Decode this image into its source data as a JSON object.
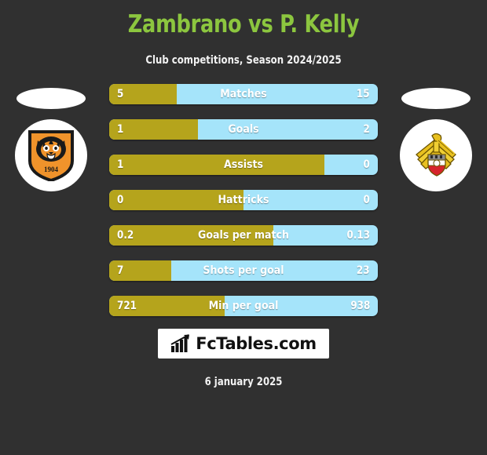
{
  "header": {
    "title": "Zambrano vs P. Kelly",
    "subtitle": "Club competitions, Season 2024/2025",
    "title_color": "#8cc63f",
    "background_color": "#303030"
  },
  "colors": {
    "home_bar": "#b5a41c",
    "away_bar": "#a5e4fa",
    "text": "#ffffff"
  },
  "home_team": {
    "crest_icon": "hull-city-tiger-crest",
    "crest_year": "1904"
  },
  "away_team": {
    "crest_icon": "doncaster-rovers-crest"
  },
  "chart_data": {
    "type": "bar",
    "title": "Zambrano vs P. Kelly",
    "subtitle": "Club competitions, Season 2024/2025",
    "orientation": "horizontal-diverging",
    "legend": [
      "Zambrano",
      "P. Kelly"
    ],
    "categories": [
      "Matches",
      "Goals",
      "Assists",
      "Hattricks",
      "Goals per match",
      "Shots per goal",
      "Min per goal"
    ],
    "series": [
      {
        "name": "Zambrano",
        "color": "#b5a41c",
        "values": [
          5,
          1,
          1,
          0,
          0.2,
          7,
          721
        ]
      },
      {
        "name": "P. Kelly",
        "color": "#a5e4fa",
        "values": [
          15,
          2,
          0,
          0,
          0.13,
          23,
          938
        ]
      }
    ]
  },
  "rows": [
    {
      "label": "Matches",
      "home": "5",
      "away": "15",
      "home_pct": 25
    },
    {
      "label": "Goals",
      "home": "1",
      "away": "2",
      "home_pct": 33
    },
    {
      "label": "Assists",
      "home": "1",
      "away": "0",
      "home_pct": 80
    },
    {
      "label": "Hattricks",
      "home": "0",
      "away": "0",
      "home_pct": 50
    },
    {
      "label": "Goals per match",
      "home": "0.2",
      "away": "0.13",
      "home_pct": 61
    },
    {
      "label": "Shots per goal",
      "home": "7",
      "away": "23",
      "home_pct": 23
    },
    {
      "label": "Min per goal",
      "home": "721",
      "away": "938",
      "home_pct": 43
    }
  ],
  "footer": {
    "brand_name": "FcTables.com",
    "brand_icon": "bar-chart-arrow-icon",
    "date": "6 january 2025"
  }
}
